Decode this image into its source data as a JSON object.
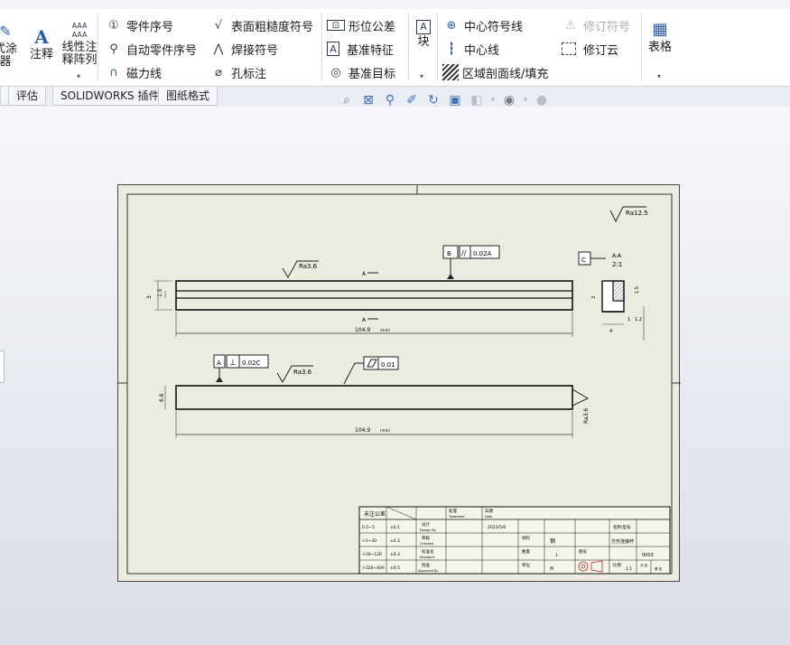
{
  "ribbon": {
    "left_big": {
      "line1": "式涂",
      "line2": "器"
    },
    "annotation_big": {
      "label": "注释"
    },
    "linear_note_pattern": {
      "glyph": "AAA",
      "line1": "线性注",
      "line2": "释阵列"
    },
    "group1": [
      {
        "label": "零件序号",
        "icon": "balloon-icon"
      },
      {
        "label": "自动零件序号",
        "icon": "auto-balloon-icon"
      },
      {
        "label": "磁力线",
        "icon": "magnet-line-icon"
      }
    ],
    "group2": [
      {
        "label": "表面粗糙度符号",
        "icon": "surface-finish-icon"
      },
      {
        "label": "焊接符号",
        "icon": "weld-symbol-icon"
      },
      {
        "label": "孔标注",
        "icon": "hole-callout-icon"
      }
    ],
    "group3": [
      {
        "label": "形位公差",
        "icon": "geometric-tolerance-icon"
      },
      {
        "label": "基准特征",
        "icon": "datum-feature-icon"
      },
      {
        "label": "基准目标",
        "icon": "datum-target-icon"
      }
    ],
    "block_big": {
      "label": "块"
    },
    "group4": [
      {
        "label": "中心符号线",
        "icon": "center-mark-icon"
      },
      {
        "label": "中心线",
        "icon": "centerline-icon"
      },
      {
        "label": "区域剖面线/填充",
        "icon": "area-hatch-icon"
      }
    ],
    "group5": [
      {
        "label": "修订符号",
        "icon": "revision-symbol-icon",
        "disabled": true
      },
      {
        "label": "修订云",
        "icon": "revision-cloud-icon"
      }
    ],
    "table_big": {
      "label": "表格"
    }
  },
  "tabs": [
    "评估",
    "SOLIDWORKS 插件",
    "图纸格式"
  ],
  "drawing": {
    "roughness_global": "Ra12.5",
    "roughness_top": "Ra3.6",
    "roughness_front": "Ra3.6",
    "roughness_side": "Ra3.6",
    "geo_tol_parallel": {
      "datum": "B",
      "value": "0.02A"
    },
    "geo_tol_perp": {
      "datum": "A",
      "value": "0.02C"
    },
    "geo_tol_flat": {
      "value": "0.01"
    },
    "section_label_top": "A",
    "section_label_bottom": "A",
    "dim_top_length": "104.9",
    "dim_bottom_length": "104.9",
    "dim_unit": "(mm)",
    "detail_datum": "C",
    "detail_view_name": "A-A",
    "detail_scale": "2:1",
    "dim_left_a": "3",
    "dim_left_b": "1.5",
    "dim_front_height": "6.6",
    "dim_det_1": "1.2",
    "dim_det_2": "1",
    "dim_det_3": "4",
    "dim_det_4": "1.5",
    "dim_det_5": "3",
    "title_block": {
      "col_heads": [
        "处理",
        "日期"
      ],
      "col_heads_en": [
        "Treatment",
        "Date"
      ],
      "tol_head": "未注公差",
      "tol_rows": [
        {
          "range": "0.5~3",
          "tol": "±0.1"
        },
        {
          "range": ">3~30",
          "tol": "±0.2"
        },
        {
          "range": ">30~120",
          "tol": "±0.3"
        },
        {
          "range": ">120~400",
          "tol": "±0.5"
        }
      ],
      "role_rows": [
        {
          "cn": "设计",
          "en": "Design By"
        },
        {
          "cn": "审核",
          "en": "Checked"
        },
        {
          "cn": "标准化",
          "en": "Standard"
        },
        {
          "cn": "批准",
          "en": "Approved By"
        }
      ],
      "date_value": "2023/5/6",
      "material_label": "材料",
      "material_value": "钢",
      "qty_label": "数量",
      "qty_value": "1",
      "unit_label": "单位",
      "unit_value": "件",
      "part_name_label": "名称/型号",
      "part_name_value": "方形连接杆",
      "drawing_no_label": "图号",
      "drawing_no_value": "0003",
      "scale_label": "比例",
      "scale_value": "1:1",
      "sheet_label": "共 张",
      "sheet_value": "第 张"
    }
  }
}
